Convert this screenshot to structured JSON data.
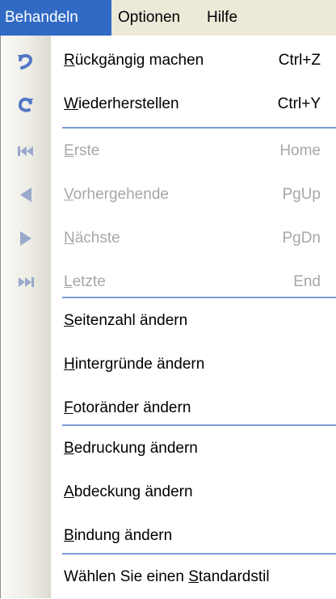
{
  "menubar": {
    "items": [
      {
        "label": "Behandeln",
        "active": true
      },
      {
        "label": "Optionen",
        "active": false
      },
      {
        "label": "Hilfe",
        "active": false
      }
    ]
  },
  "menu": {
    "items": [
      {
        "pre": "",
        "acc": "R",
        "post": "ückgängig machen",
        "shortcut": "Ctrl+Z",
        "icon": "undo-icon",
        "enabled": true
      },
      {
        "pre": "",
        "acc": "W",
        "post": "iederherstellen",
        "shortcut": "Ctrl+Y",
        "icon": "redo-icon",
        "enabled": true
      },
      {
        "pre": "",
        "acc": "E",
        "post": "rste",
        "shortcut": "Home",
        "icon": "first-page-icon",
        "enabled": false
      },
      {
        "pre": "",
        "acc": "V",
        "post": "orhergehende",
        "shortcut": "PgUp",
        "icon": "previous-page-icon",
        "enabled": false
      },
      {
        "pre": "",
        "acc": "N",
        "post": "ächste",
        "shortcut": "PgDn",
        "icon": "next-page-icon",
        "enabled": false
      },
      {
        "pre": "",
        "acc": "L",
        "post": "etzte",
        "shortcut": "End",
        "icon": "last-page-icon",
        "enabled": false
      },
      {
        "pre": "",
        "acc": "S",
        "post": "eitenzahl ändern",
        "shortcut": "",
        "icon": "",
        "enabled": true
      },
      {
        "pre": "",
        "acc": "H",
        "post": "intergründe ändern",
        "shortcut": "",
        "icon": "",
        "enabled": true
      },
      {
        "pre": "",
        "acc": "F",
        "post": "otoränder ändern",
        "shortcut": "",
        "icon": "",
        "enabled": true
      },
      {
        "pre": "",
        "acc": "B",
        "post": "edruckung ändern",
        "shortcut": "",
        "icon": "",
        "enabled": true
      },
      {
        "pre": "",
        "acc": "A",
        "post": "bdeckung ändern",
        "shortcut": "",
        "icon": "",
        "enabled": true
      },
      {
        "pre": "",
        "acc": "B",
        "post": "indung ändern",
        "shortcut": "",
        "icon": "",
        "enabled": true
      },
      {
        "pre": "Wählen Sie einen ",
        "acc": "S",
        "post": "tandardstil",
        "shortcut": "",
        "icon": "",
        "enabled": true
      }
    ]
  },
  "colors": {
    "menubar_bg": "#ece9d8",
    "highlight": "#316ac5",
    "separator": "#7a9bd6",
    "disabled_text": "#a7a6aa",
    "icon_enabled": "#5277c6",
    "icon_disabled": "#9aa9cc"
  }
}
